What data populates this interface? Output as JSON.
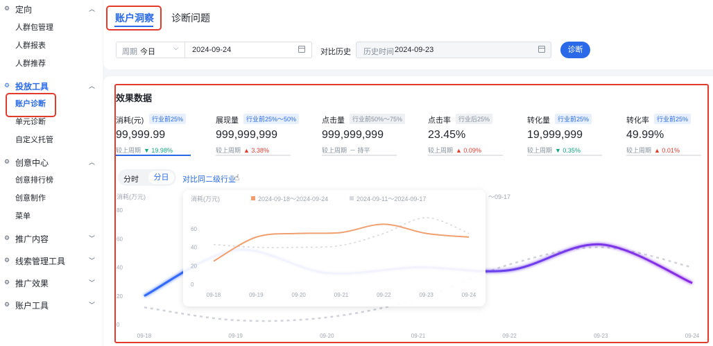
{
  "sidebar": {
    "sections": [
      {
        "label": "定向",
        "items": [
          "人群包管理",
          "人群报表",
          "人群推荐"
        ]
      },
      {
        "label": "投放工具",
        "items": [
          "账户诊断",
          "单元诊断",
          "自定义托管"
        ]
      },
      {
        "label": "创意中心",
        "items": [
          "创意排行榜",
          "创意制作",
          "菜单"
        ]
      },
      {
        "label": "推广内容",
        "items": []
      },
      {
        "label": "线索管理工具",
        "items": []
      },
      {
        "label": "推广效果",
        "items": []
      },
      {
        "label": "账户工具",
        "items": []
      }
    ]
  },
  "tabs": [
    "账户洞察",
    "诊断问题"
  ],
  "filters": {
    "period_label": "周期",
    "period_value": "今日",
    "date": "2024-09-24",
    "compare_label": "对比历史",
    "history_label": "历史时间",
    "history_date": "2024-09-23",
    "diagnose_button": "诊断"
  },
  "panel": {
    "title": "效果数据",
    "compare_prefix": "较上周期"
  },
  "metrics": [
    {
      "name": "消耗(元)",
      "badge": "行业前25%",
      "value": "99,999.99",
      "delta": "19.98%",
      "dir": "down"
    },
    {
      "name": "展现量",
      "badge": "行业前25%～50%",
      "value": "999,999,999",
      "delta": "3.38%",
      "dir": "up"
    },
    {
      "name": "点击量",
      "badge": "行业前50%～75%",
      "value": "999,999,999",
      "delta": "持平",
      "dir": "flat"
    },
    {
      "name": "点击率",
      "badge": "行业后25%",
      "value": "23.45%",
      "delta": "0.09%",
      "dir": "up"
    },
    {
      "name": "转化量",
      "badge": "行业前25%",
      "value": "19,999,999",
      "delta": "0.35%",
      "dir": "down"
    },
    {
      "name": "转化率",
      "badge": "行业前25%",
      "value": "49.99%",
      "delta": "0.01%",
      "dir": "up"
    }
  ],
  "chart_controls": {
    "seg_hour": "分时",
    "seg_day": "分日",
    "compare_industry": "对比同二级行业"
  },
  "colors": {
    "accent": "#2a6ae9",
    "up": "#e23b2e",
    "down": "#10a37f",
    "highlight_box": "#e23b2e",
    "current_series": "#f0a070",
    "main_start": "#2f6bff",
    "main_end": "#8a2be2"
  },
  "chart_data": {
    "type": "line",
    "ylabel": "消耗(万元)",
    "ylim": [
      0,
      80
    ],
    "yticks": [
      0,
      20,
      40,
      60,
      80
    ],
    "categories": [
      "09-18",
      "09-19",
      "09-20",
      "09-21",
      "09-22",
      "09-23",
      "09-24"
    ],
    "main": {
      "current": [
        20,
        52,
        36,
        40,
        38,
        56,
        29
      ],
      "previous": [
        12,
        3,
        5,
        18,
        42,
        54,
        40
      ]
    },
    "tooltip": {
      "ylabel": "消耗(万元)",
      "legend": [
        "2024-09-18～2024-09-24",
        "2024-09-11～2024-09-17"
      ],
      "yticks": [
        0,
        20,
        40,
        60
      ],
      "categories": [
        "09-18",
        "09-19",
        "09-20",
        "09-21",
        "09-22",
        "09-23",
        "09-24"
      ],
      "current": [
        25,
        51,
        55,
        56,
        65,
        55,
        51
      ],
      "previous": [
        43,
        40,
        40,
        42,
        55,
        72,
        55
      ]
    },
    "partial_label": "～09-17"
  }
}
